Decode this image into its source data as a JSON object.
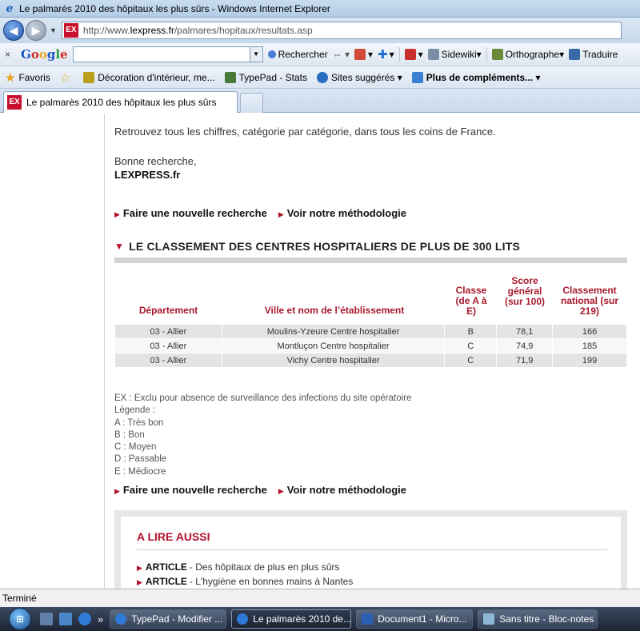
{
  "window": {
    "title": "Le palmarès 2010 des hôpitaux les plus sûrs - Windows Internet Explorer"
  },
  "address": {
    "host_prefix": "http://www.",
    "host": "lexpress.fr",
    "path": "/palmares/hopitaux/resultats.asp",
    "favicon_text": "EX"
  },
  "google_toolbar": {
    "close": "×",
    "logo": [
      "G",
      "o",
      "o",
      "g",
      "l",
      "e"
    ],
    "search_label": "Rechercher",
    "sidewiki": "Sidewiki",
    "orthographe": "Orthographe",
    "traduire": "Traduire"
  },
  "favorites": {
    "label": "Favoris",
    "items": [
      "Décoration d'intérieur, me...",
      "TypePad - Stats",
      "Sites suggérés ▾",
      "Plus de compléments... ▾"
    ]
  },
  "tab": {
    "title": "Le palmarès 2010 des hôpitaux les plus sûrs",
    "favicon_text": "EX"
  },
  "page": {
    "intro": "Retrouvez tous les chiffres, catégorie par catégorie, dans tous les coins de France.",
    "greeting": "Bonne recherche,",
    "brand": "LEXPRESS.fr",
    "link_new_search": "Faire une nouvelle recherche",
    "link_method": "Voir notre méthodologie",
    "section_title": "LE CLASSEMENT DES CENTRES HOSPITALIERS DE PLUS DE 300 LITS",
    "headers": {
      "dept": "Département",
      "name": "Ville et nom de l’établissement",
      "classe": "Classe (de A à E)",
      "score": "Score général (sur 100)",
      "national": "Classement national (sur 219)"
    },
    "rows": [
      [
        "03 - Allier",
        "Moulins-Yzeure Centre hospitalier",
        "B",
        "78,1",
        "166"
      ],
      [
        "03 - Allier",
        "Montluçon Centre hospitalier",
        "C",
        "74,9",
        "185"
      ],
      [
        "03 - Allier",
        "Vichy Centre hospitalier",
        "C",
        "71,9",
        "199"
      ]
    ],
    "legend": [
      "EX : Exclu pour absence de surveillance des infections du site opératoire",
      "Légende :",
      "A : Très bon",
      "B : Bon",
      "C : Moyen",
      "D : Passable",
      "E : Médiocre"
    ],
    "aside_title": "A LIRE AUSSI",
    "articles": [
      {
        "kind": "ARTICLE",
        "text": "- Des hôpitaux de plus en plus sûrs"
      },
      {
        "kind": "ARTICLE",
        "text": "- L'hygiène en bonnes mains à Nantes"
      }
    ]
  },
  "status": "Terminé",
  "taskbar": {
    "buttons": [
      "TypePad - Modifier ...",
      "Le palmarès 2010 de...",
      "Document1 - Micro...",
      "Sans titre - Bloc-notes"
    ],
    "overflow": "»"
  }
}
